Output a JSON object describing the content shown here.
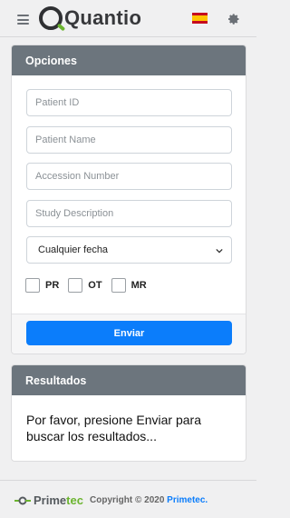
{
  "header": {
    "logo_text": "Quantio",
    "language_flag": "flag-es-icon",
    "menu_icon": "hamburger-icon",
    "settings_icon": "gear-icon"
  },
  "opciones": {
    "title": "Opciones",
    "fields": {
      "patient_id_placeholder": "Patient ID",
      "patient_name_placeholder": "Patient Name",
      "accession_placeholder": "Accession Number",
      "study_description_placeholder": "Study Description"
    },
    "date_select": {
      "selected": "Cualquier fecha"
    },
    "modalities": [
      "PR",
      "OT",
      "MR"
    ],
    "submit_label": "Enviar"
  },
  "resultados": {
    "title": "Resultados",
    "message": "Por favor, presione Enviar para buscar los resultados..."
  },
  "footer": {
    "brand_prime": "Prime",
    "brand_tec": "tec",
    "copyright_prefix": "Copyright © 2020 ",
    "copyright_link": "Primetec."
  },
  "colors": {
    "accent": "#0b7dfb",
    "panel_header": "#6c757d",
    "brand_green": "#6bb42f"
  }
}
